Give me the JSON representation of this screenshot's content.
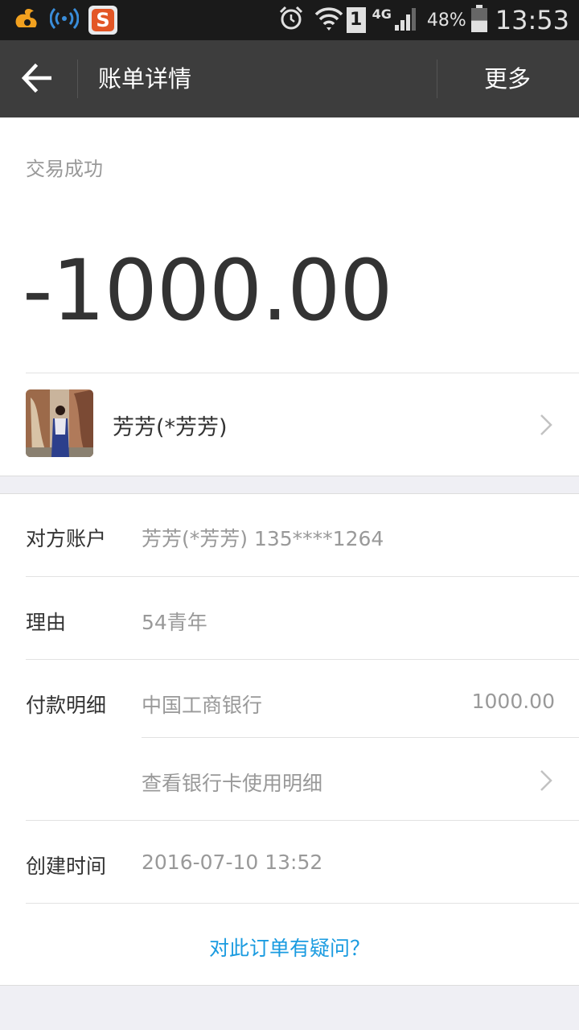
{
  "status_bar": {
    "network_type": "4G",
    "sim_label": "1",
    "battery_percent": "48%",
    "battery_level": 0.48,
    "time": "13:53",
    "sogou_letter": "S",
    "icons": [
      "uc-browser-icon",
      "wifi-app-icon",
      "sogou-input-icon",
      "alarm-icon",
      "wifi-icon",
      "sim-icon",
      "signal-icon",
      "battery-icon"
    ]
  },
  "header": {
    "back_icon": "arrow-left-icon",
    "title": "账单详情",
    "more_label": "更多"
  },
  "transaction": {
    "status": "交易成功",
    "amount": "-1000.00"
  },
  "counterparty": {
    "name": "芳芳(*芳芳)"
  },
  "details": {
    "account_label": "对方账户",
    "account_value": "芳芳(*芳芳) 135****1264",
    "reason_label": "理由",
    "reason_value": "54青年",
    "payment_label": "付款明细",
    "payment_bank": "中国工商银行",
    "payment_amount": "1000.00",
    "card_usage_link": "查看银行卡使用明细",
    "created_label": "创建时间",
    "created_value": "2016-07-10 13:52"
  },
  "question_link": "对此订单有疑问？",
  "colors": {
    "status_bar_bg": "#1a1a1a",
    "title_bar_bg": "#3d3d3d",
    "link": "#1a9be0",
    "page_bg": "#efeff4"
  }
}
